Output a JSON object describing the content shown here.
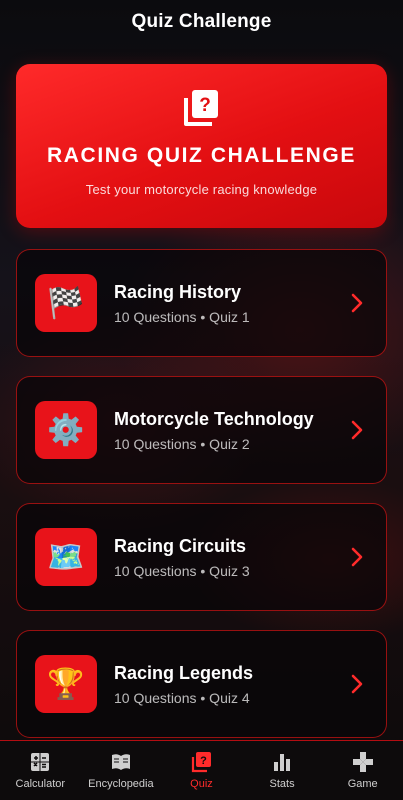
{
  "header": {
    "title": "Quiz Challenge"
  },
  "hero": {
    "icon": "quiz-icon",
    "title": "RACING QUIZ CHALLENGE",
    "subtitle": "Test your motorcycle racing knowledge",
    "color": "#e8131a"
  },
  "quizzes": [
    {
      "title": "Racing History",
      "meta": "10 Questions • Quiz 1",
      "icon": "checkered-flag-icon",
      "glyph": "🏁"
    },
    {
      "title": "Motorcycle Technology",
      "meta": "10 Questions • Quiz 2",
      "icon": "gear-icon",
      "glyph": "⚙️"
    },
    {
      "title": "Racing Circuits",
      "meta": "10 Questions • Quiz 3",
      "icon": "map-icon",
      "glyph": "🗺️"
    },
    {
      "title": "Racing Legends",
      "meta": "10 Questions • Quiz 4",
      "icon": "trophy-icon",
      "glyph": "🏆"
    }
  ],
  "nav": {
    "items": [
      {
        "label": "Calculator",
        "icon": "calculator-icon"
      },
      {
        "label": "Encyclopedia",
        "icon": "book-icon"
      },
      {
        "label": "Quiz",
        "icon": "quiz-icon",
        "active": true
      },
      {
        "label": "Stats",
        "icon": "bar-chart-icon"
      },
      {
        "label": "Game",
        "icon": "gamepad-icon"
      }
    ],
    "active_color": "#ff2b2b"
  }
}
